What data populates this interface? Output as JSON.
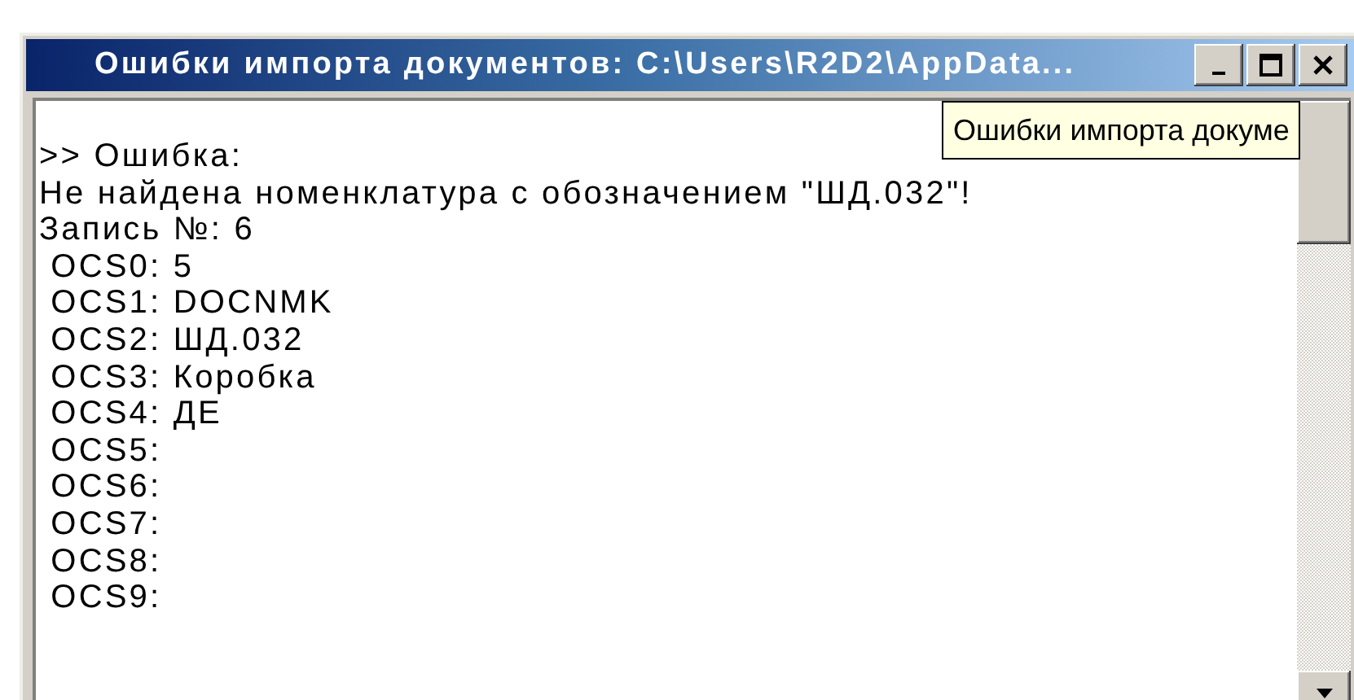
{
  "window": {
    "title": "Ошибки импорта документов: C:\\Users\\R2D2\\AppData..."
  },
  "tooltip": "Ошибки импорта докуме",
  "log_lines": [
    ">> Ошибка:",
    "Не найдена номенклатура с обозначением \"ШД.032\"!",
    "Запись №: 6",
    " OCS0: 5",
    " OCS1: DOCNMK",
    " OCS2: ШД.032",
    " OCS3: Коробка",
    " OCS4: ДЕ",
    " OCS5:",
    " OCS6:",
    " OCS7:",
    " OCS8:",
    " OCS9:"
  ]
}
